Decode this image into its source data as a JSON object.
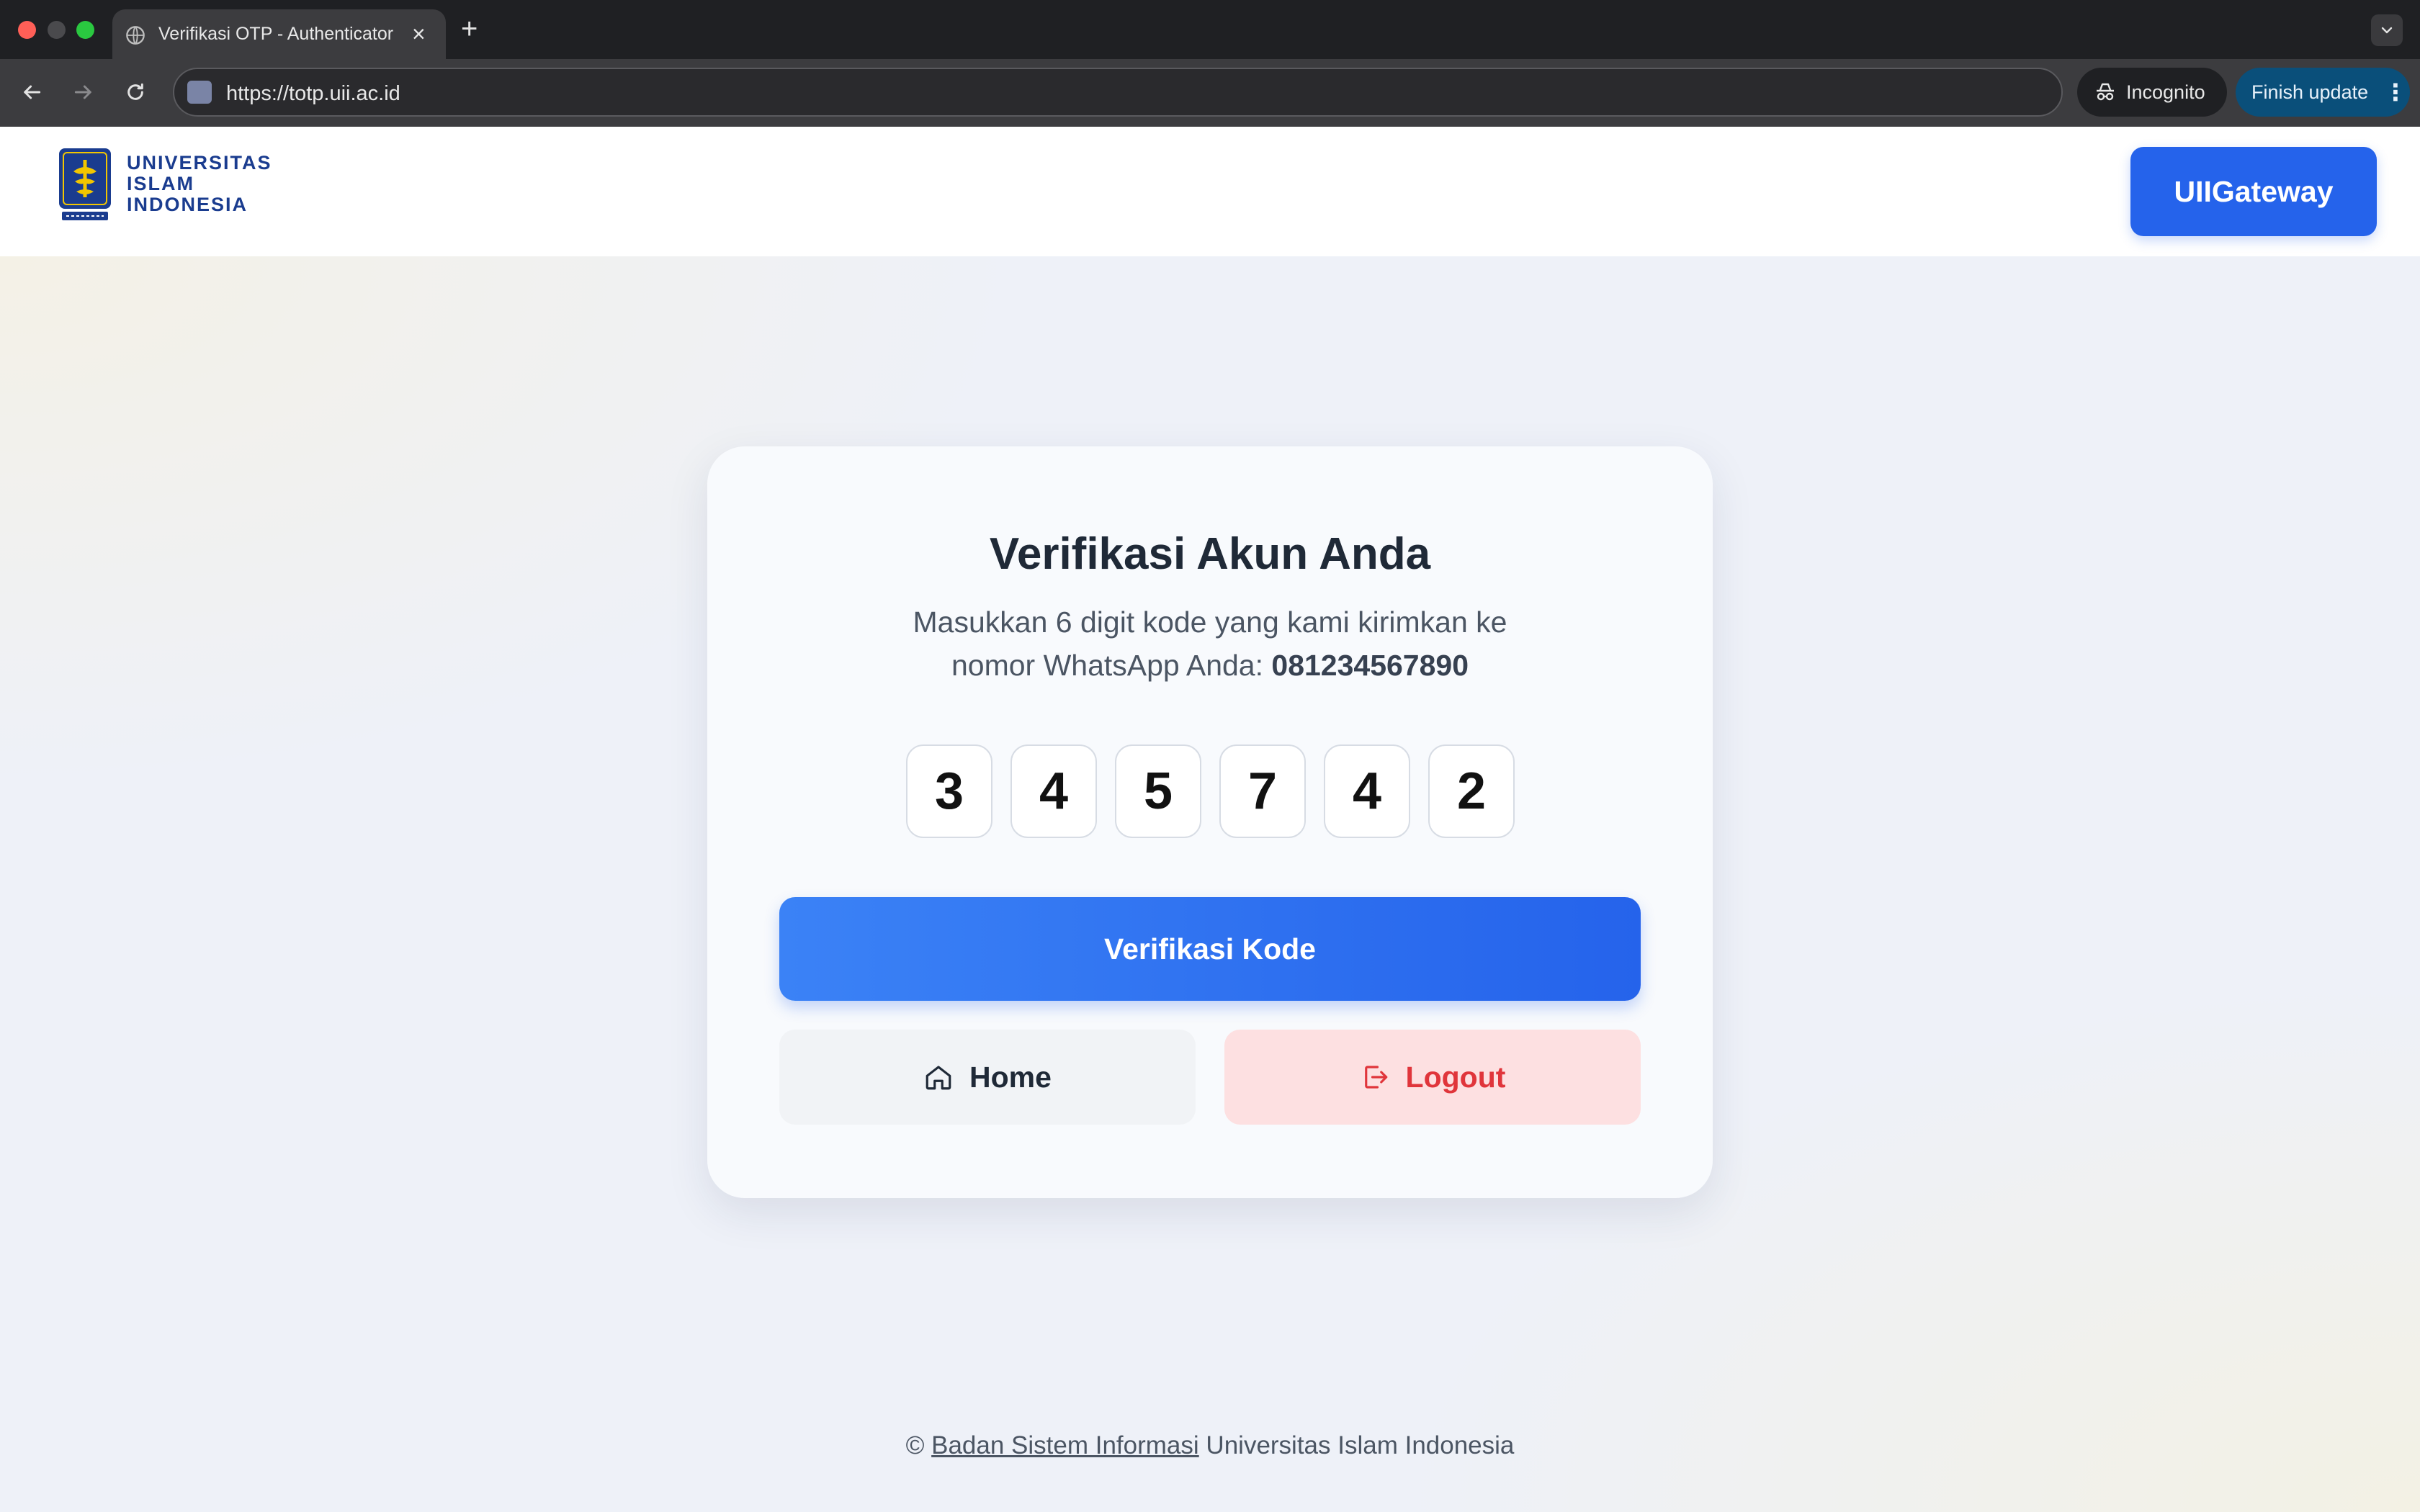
{
  "browser": {
    "tab_title": "Verifikasi OTP - Authenticator",
    "url": "https://totp.uii.ac.id",
    "incognito_label": "Incognito",
    "finish_update_label": "Finish update"
  },
  "header": {
    "logo_lines": [
      "UNIVERSITAS",
      "ISLAM",
      "INDONESIA"
    ],
    "gateway_button": "UIIGateway"
  },
  "card": {
    "title": "Verifikasi Akun Anda",
    "description_line1": "Masukkan 6 digit kode yang kami kirimkan ke",
    "description_line2": "nomor WhatsApp Anda: ",
    "phone": "081234567890",
    "otp_digits": [
      "3",
      "4",
      "5",
      "7",
      "4",
      "2"
    ],
    "verify_button": "Verifikasi Kode",
    "home_button": "Home",
    "logout_button": "Logout"
  },
  "footer": {
    "copyright": "©",
    "link_text": "Badan Sistem Informasi",
    "suffix": "Universitas Islam Indonesia"
  },
  "colors": {
    "primary": "#2563eb",
    "logout_bg": "#fde0e1",
    "logout_text": "#e0353b",
    "logo_blue": "#1a3c8f"
  }
}
